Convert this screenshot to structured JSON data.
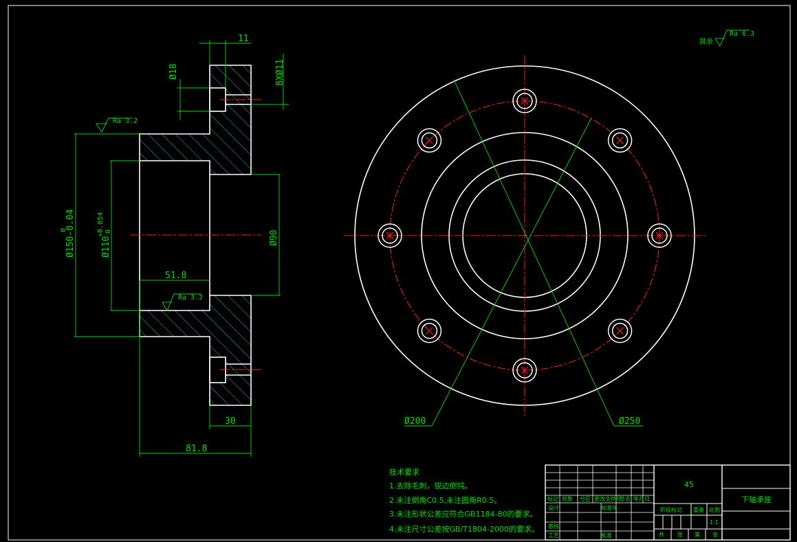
{
  "surface_finish": {
    "general_label": "其余",
    "general_value": "Ra 6.3",
    "top_value": "Ra 3.2",
    "bore_value": "Ra 3.2"
  },
  "dimensions": {
    "d11": "11",
    "d18": "Ø18",
    "holes": "8XØ11",
    "d150": "Ø150-0.04",
    "d150_upper": "0",
    "d110": "Ø110",
    "d110_upper": "+0.054",
    "d110_lower": "0",
    "d90": "Ø90",
    "d51_8": "51.8",
    "d30": "30",
    "d81_8": "81.8",
    "d200": "Ø200",
    "d250": "Ø250"
  },
  "notes": {
    "title": "技术要求",
    "items": [
      "1.去除毛刺，锐边倒钝。",
      "2.未注倒角C0.5,未注圆角R0.5。",
      "3.未注形状公差应符合GB1184-80的要求。",
      "4.未注尺寸公差按GB/T1804-2000的要求。"
    ]
  },
  "title_block": {
    "material": "45",
    "part_name": "下轴承座",
    "row_labels": [
      "标记",
      "处数",
      "分区",
      "更改文件号",
      "签名",
      "年月日"
    ],
    "design": "设计",
    "standardize": "标准化",
    "review": "审核",
    "process": "工艺",
    "approve": "批准",
    "stage_mark": "阶段标记",
    "weight": "重量",
    "scale_label": "比例",
    "scale": "1:1",
    "sheet_info": [
      "共",
      "张",
      "第",
      "张"
    ]
  }
}
